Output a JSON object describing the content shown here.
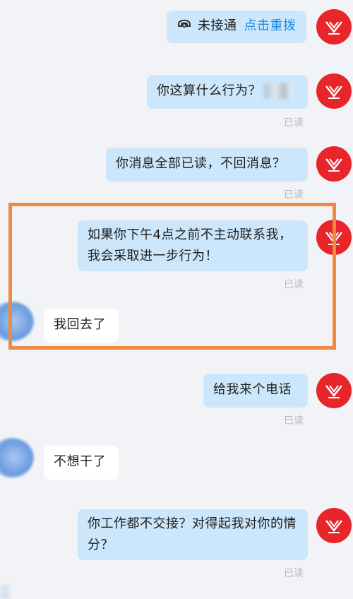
{
  "messages": {
    "missed_call": {
      "status": "未接通",
      "redial": "点击重拨"
    },
    "m1": {
      "text": "你这算什么行为？",
      "read": "已读"
    },
    "m2": {
      "text": "你消息全部已读，不回消息？",
      "read": "已读"
    },
    "m3": {
      "text": "如果你下午4点之前不主动联系我，我会采取进一步行为！",
      "read": "已读"
    },
    "r1": {
      "text": "我回去了"
    },
    "m4": {
      "text": "给我来个电话",
      "read": "已读"
    },
    "r2": {
      "text": "不想干了"
    },
    "m5": {
      "text": "你工作都不交接？对得起我对你的情分？",
      "read": "已读"
    }
  },
  "colors": {
    "background": "#f2f3f6",
    "my_bubble": "#cce7fb",
    "other_bubble": "#ffffff",
    "avatar_red": "#e8252b",
    "redial_link": "#1e8ae6",
    "highlight_border": "#ef8a45"
  },
  "icons": {
    "call": "phone-icon",
    "avatar_logo": "logo-icon"
  }
}
